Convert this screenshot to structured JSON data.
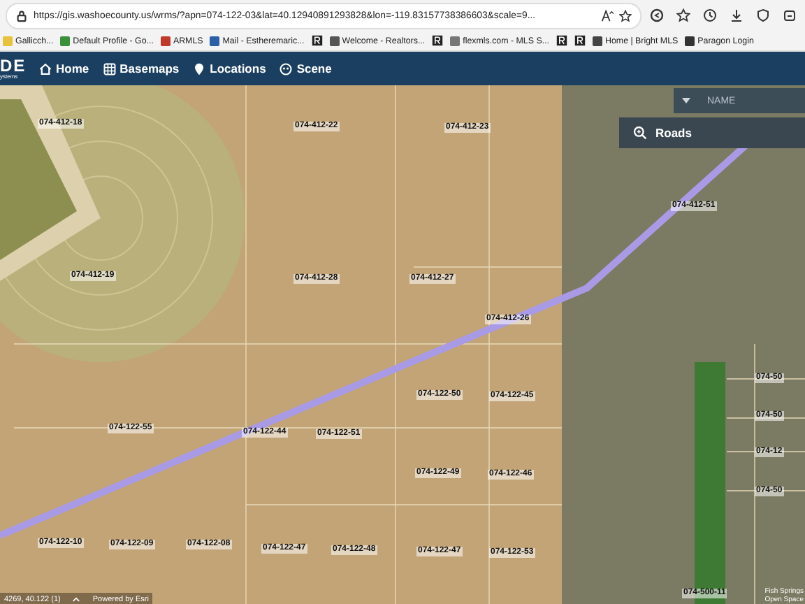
{
  "browser": {
    "url": "https://gis.washoecounty.us/wrms/?apn=074-122-03&lat=40.12940891293828&lon=-119.83157738386603&scale=9...",
    "bookmarks": [
      {
        "kind": "link",
        "label": "Gallicch..."
      },
      {
        "kind": "link",
        "label": "Default Profile - Go..."
      },
      {
        "kind": "link",
        "label": "ARMLS"
      },
      {
        "kind": "link",
        "label": "Mail - Estheremaric..."
      },
      {
        "kind": "icon"
      },
      {
        "kind": "link",
        "label": "Welcome - Realtors..."
      },
      {
        "kind": "icon"
      },
      {
        "kind": "link",
        "label": "flexmls.com - MLS S..."
      },
      {
        "kind": "icon"
      },
      {
        "kind": "icon"
      },
      {
        "kind": "link",
        "label": "Home | Bright MLS"
      },
      {
        "kind": "link",
        "label": "Paragon Login"
      }
    ]
  },
  "app": {
    "logo": "DE",
    "logo_sub": "ystems",
    "nav": [
      {
        "label": "Home"
      },
      {
        "label": "Basemaps"
      },
      {
        "label": "Locations"
      },
      {
        "label": "Scene"
      }
    ]
  },
  "map": {
    "search": {
      "placeholder": "NAME"
    },
    "result": "Roads",
    "parcels": [
      "074-412-18",
      "074-412-22",
      "074-412-23",
      "074-412-19",
      "074-412-28",
      "074-412-27",
      "074-412-26",
      "074-412-51",
      "074-122-55",
      "074-122-44",
      "074-122-51",
      "074-122-50",
      "074-122-45",
      "074-122-49",
      "074-122-46",
      "074-122-47",
      "074-122-53",
      "074-122-10",
      "074-122-09",
      "074-122-08",
      "074-122-47",
      "074-122-48",
      "074-500-11",
      "074-50",
      "074-50",
      "074-12",
      "074-50"
    ],
    "coordinates": "4269, 40.122 (1)",
    "attribution": "Powered by Esri",
    "credit": "Fish Springs Open Space"
  }
}
